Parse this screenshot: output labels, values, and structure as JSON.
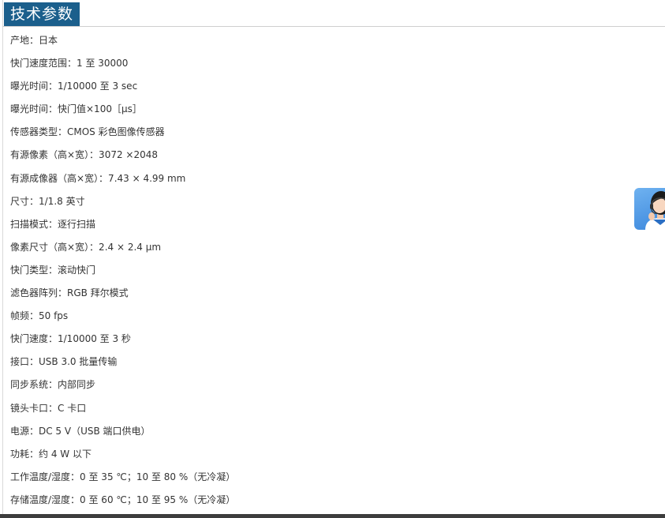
{
  "section": {
    "title": "技术参数"
  },
  "specs": [
    "产地：日本",
    "快门速度范围：1 至 30000",
    "曝光时间：1/10000 至 3 sec",
    "曝光时间：快门值×100［μs］",
    "传感器类型：CMOS 彩色图像传感器",
    "有源像素（高×宽）：3072 ×2048",
    "有源成像器（高×宽）：7.43 × 4.99 mm",
    "尺寸：1/1.8 英寸",
    "扫描模式：逐行扫描",
    "像素尺寸（高×宽）：2.4 × 2.4 μm",
    "快门类型：滚动快门",
    "滤色器阵列：RGB 拜尔模式",
    "帧频：50 fps",
    "快门速度：1/10000 至 3 秒",
    "接口：USB 3.0 批量传输",
    "同步系统：内部同步",
    "镜头卡口：C 卡口",
    "电源：DC 5 V（USB 端口供电）",
    "功耗：约 4 W 以下",
    "工作温度/湿度：0 至 35 ℃；10 至 80 %（无冷凝）",
    "存储温度/湿度：0 至 60 ℃；10 至 95 %（无冷凝）"
  ],
  "widget": {
    "icon": "customer-service-avatar-icon"
  },
  "colors": {
    "title_bg": "#1b5f8c",
    "text": "#333333",
    "divider": "#cfcfcf",
    "widget_bg": "#3a86dc"
  }
}
